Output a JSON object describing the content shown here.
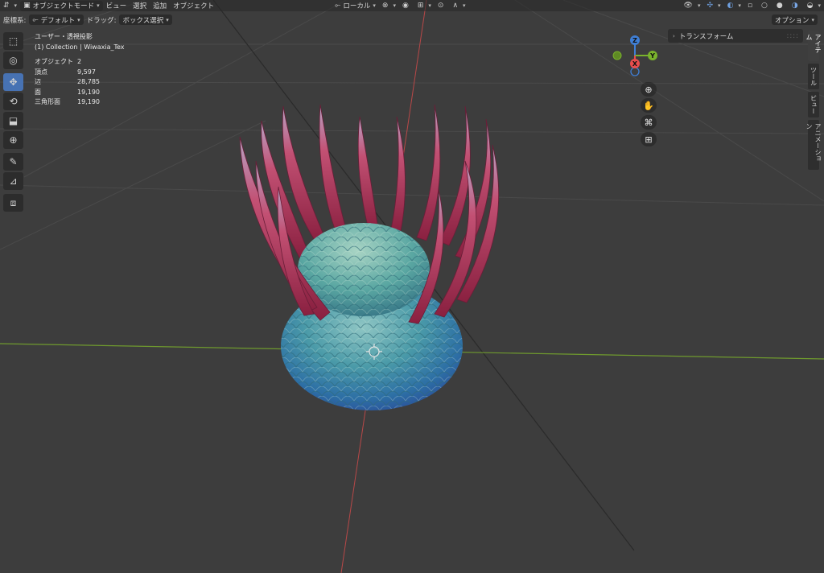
{
  "header": {
    "mode_label": "オブジェクトモード",
    "menus": [
      "ビュー",
      "選択",
      "追加",
      "オブジェクト"
    ],
    "transform_orientation": "ローカル"
  },
  "toolbar2": {
    "coord_label": "座標系:",
    "coord_value": "デフォルト",
    "drag_label": "ドラッグ:",
    "drag_value": "ボックス選択",
    "options_label": "オプション"
  },
  "stats": {
    "view_name": "ユーザー・透視投影",
    "collection": "(1) Collection | Wiwaxia_Tex",
    "rows": [
      {
        "label": "オブジェクト",
        "value": "2"
      },
      {
        "label": "頂点",
        "value": "9,597"
      },
      {
        "label": "辺",
        "value": "28,785"
      },
      {
        "label": "面",
        "value": "19,190"
      },
      {
        "label": "三角形面",
        "value": "19,190"
      }
    ]
  },
  "gizmo": {
    "x": "X",
    "y": "Y",
    "z": "Z"
  },
  "npanel": {
    "transform_title": "トランスフォーム",
    "tabs": [
      "アイテム",
      "ツール",
      "ビュー",
      "アニメーション"
    ]
  },
  "colors": {
    "accent": "#4772b3",
    "axis_x": "#e84d4d",
    "axis_y": "#7ab32c",
    "axis_z": "#3f7fd6"
  }
}
